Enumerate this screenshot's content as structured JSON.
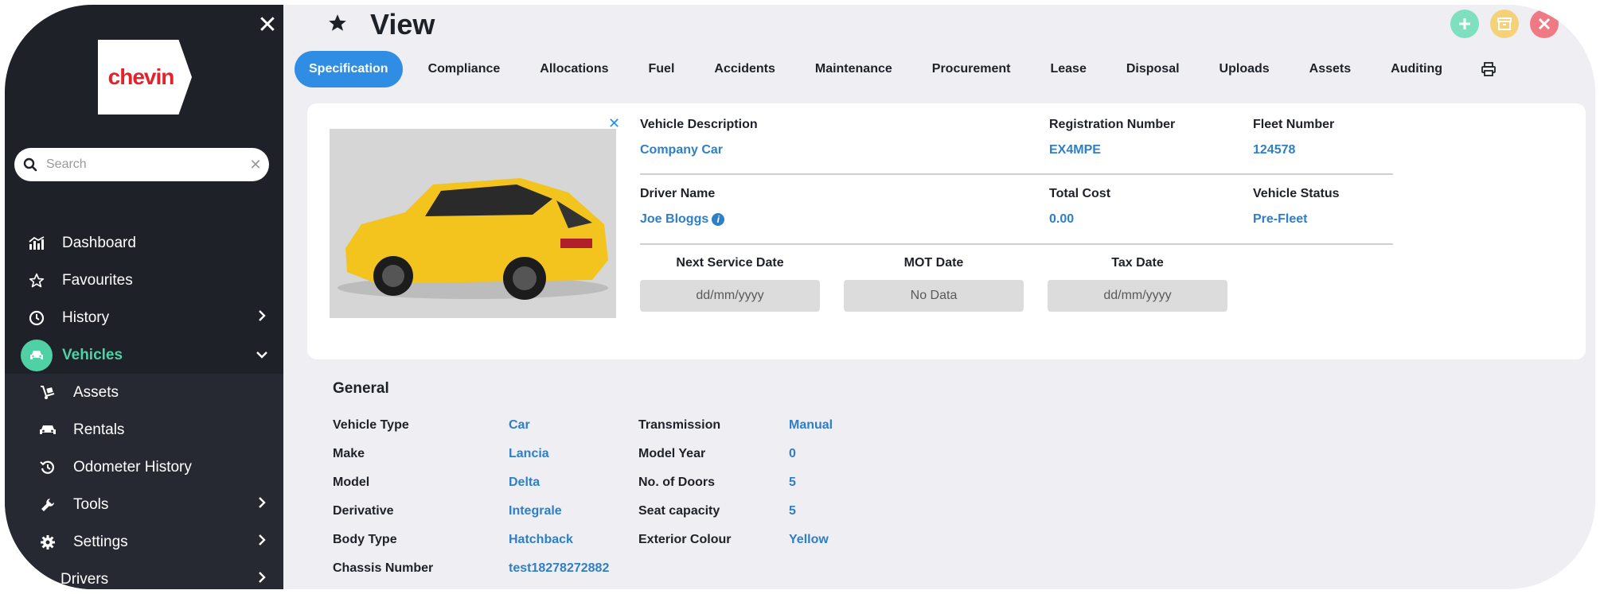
{
  "sidebar": {
    "logo_text": "chevin",
    "search_placeholder": "Search",
    "items": [
      {
        "label": "Dashboard"
      },
      {
        "label": "Favourites"
      },
      {
        "label": "History"
      },
      {
        "label": "Vehicles"
      },
      {
        "label": "Assets"
      },
      {
        "label": "Rentals"
      },
      {
        "label": "Odometer History"
      },
      {
        "label": "Tools"
      },
      {
        "label": "Settings"
      },
      {
        "label": "Drivers"
      }
    ]
  },
  "header": {
    "title": "View"
  },
  "tabs": [
    {
      "label": "Specification"
    },
    {
      "label": "Compliance"
    },
    {
      "label": "Allocations"
    },
    {
      "label": "Fuel"
    },
    {
      "label": "Accidents"
    },
    {
      "label": "Maintenance"
    },
    {
      "label": "Procurement"
    },
    {
      "label": "Lease"
    },
    {
      "label": "Disposal"
    },
    {
      "label": "Uploads"
    },
    {
      "label": "Assets"
    },
    {
      "label": "Auditing"
    }
  ],
  "summary": {
    "vehicle_description": {
      "label": "Vehicle Description",
      "value": "Company Car"
    },
    "registration_number": {
      "label": "Registration Number",
      "value": "EX4MPE"
    },
    "fleet_number": {
      "label": "Fleet Number",
      "value": "124578"
    },
    "driver_name": {
      "label": "Driver Name",
      "value": "Joe Bloggs"
    },
    "total_cost": {
      "label": "Total Cost",
      "value": "0.00"
    },
    "vehicle_status": {
      "label": "Vehicle Status",
      "value": "Pre-Fleet"
    },
    "next_service_date": {
      "label": "Next Service Date",
      "value": "dd/mm/yyyy"
    },
    "mot_date": {
      "label": "MOT Date",
      "value": "No Data"
    },
    "tax_date": {
      "label": "Tax Date",
      "value": "dd/mm/yyyy"
    }
  },
  "general": {
    "title": "General",
    "left": [
      {
        "label": "Vehicle Type",
        "value": "Car"
      },
      {
        "label": "Make",
        "value": "Lancia"
      },
      {
        "label": "Model",
        "value": "Delta"
      },
      {
        "label": "Derivative",
        "value": "Integrale"
      },
      {
        "label": "Body Type",
        "value": "Hatchback"
      },
      {
        "label": "Chassis Number",
        "value": "test18278272882"
      }
    ],
    "right": [
      {
        "label": "Transmission",
        "value": "Manual"
      },
      {
        "label": "Model Year",
        "value": "0"
      },
      {
        "label": "No. of Doors",
        "value": "5"
      },
      {
        "label": "Seat capacity",
        "value": "5"
      },
      {
        "label": "Exterior Colour",
        "value": "Yellow"
      }
    ]
  },
  "colors": {
    "accent": "#2f8de4",
    "sidebar_bg": "#1f2128",
    "active_green": "#4fd1a5",
    "value_blue": "#2f7fc6"
  }
}
